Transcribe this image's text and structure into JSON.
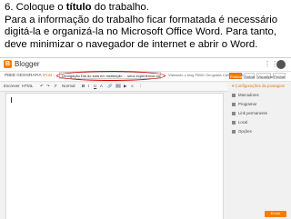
{
  "caption": {
    "line1_prefix": "6. Coloque o ",
    "line1_bold": "título",
    "line1_suffix": " do trabalho.",
    "body": "Para a informação do trabalho ficar formatada é necessário digitá-la e organizá-la no Microsoft Office Word. Para tanto, deve minimizar o navegador de internet e abrir o Word."
  },
  "blogger": {
    "brand": "Blogger",
    "blog_name": "PIBID GEOGRAFIA ›",
    "crumb": "Post ›",
    "title_value": "Divulgação Dia do sala em instituição ... seus experiência com o conhecer plano ...",
    "status": "Visitando o blog PIBID Geografia CAMPUS UNEB",
    "buttons": {
      "publish": "Publicar",
      "save": "Salvar",
      "preview": "Visualizar",
      "close": "Fechar"
    },
    "toolbar": [
      "Escrever",
      "HTML",
      "↶",
      "↷",
      "F",
      "Normal",
      "B",
      "I",
      "U",
      "A",
      "🔗",
      "🖼",
      "▶",
      "≡",
      "⋮"
    ],
    "sidebar": {
      "heading": "▾ Configurações da postagem",
      "items": [
        "Marcadores",
        "Programar",
        "Link permanente",
        "Local",
        "Opções"
      ]
    },
    "help_button": "Enviar feedback"
  }
}
